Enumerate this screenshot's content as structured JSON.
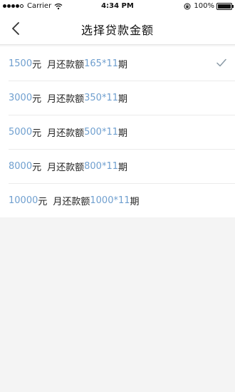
{
  "status_bar": {
    "carrier": "Carrier",
    "time": "4:34 PM",
    "battery": "100%"
  },
  "nav": {
    "title": "选择贷款金额"
  },
  "options": [
    {
      "amount": "1500",
      "unit": "元",
      "repay_label": "月还款额",
      "repay_amount": "165",
      "periods": "*11",
      "period_unit": "期",
      "selected": true
    },
    {
      "amount": "3000",
      "unit": "元",
      "repay_label": "月还款额",
      "repay_amount": "350",
      "periods": "*11",
      "period_unit": "期",
      "selected": false
    },
    {
      "amount": "5000",
      "unit": "元",
      "repay_label": "月还款额",
      "repay_amount": "500",
      "periods": "*11",
      "period_unit": "期",
      "selected": false
    },
    {
      "amount": "8000",
      "unit": "元",
      "repay_label": "月还款额",
      "repay_amount": "800",
      "periods": "*11",
      "period_unit": "期",
      "selected": false
    },
    {
      "amount": "10000",
      "unit": "元",
      "repay_label": "月还款额",
      "repay_amount": "1000",
      "periods": "*11",
      "period_unit": "期",
      "selected": false
    }
  ],
  "colors": {
    "accent_blue": "#6f9fcf",
    "check": "#8a9aa6",
    "background": "#f4f4f4"
  },
  "icons": {
    "back": "chevron-left-icon",
    "selected": "checkmark-icon"
  }
}
